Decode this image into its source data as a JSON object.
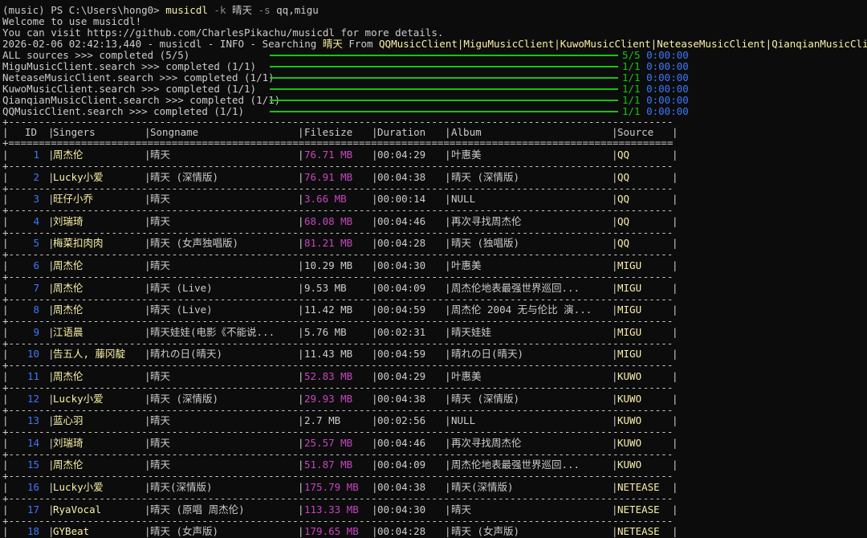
{
  "prompt": {
    "env": "(music) PS C:\\Users\\hong0> ",
    "cmd": "musicdl",
    "flag_k": "-k",
    "keyword": "晴天",
    "flag_s": "-s",
    "sources": "qq,migu"
  },
  "log": {
    "welcome": "Welcome to use musicdl!",
    "visit": "You can visit https://github.com/CharlesPikachu/musicdl for more details.",
    "info_prefix": "2026-02-06 02:42:13,440 - musicdl - INFO - Searching ",
    "info_keyword": "晴天",
    "info_from": " From ",
    "info_clients": "QQMusicClient|MiguMusicClient|KuwoMusicClient|NeteaseMusicClient|QianqianMusicClient"
  },
  "progress": [
    {
      "label": "ALL sources >>> completed (5/5)",
      "count": "5/5",
      "time": "0:00:00",
      "fraction": 1.0
    },
    {
      "label": "MiguMusicClient.search >>> completed (1/1)",
      "count": "1/1",
      "time": "0:00:00",
      "fraction": 1.0
    },
    {
      "label": "NeteaseMusicClient.search >>> completed (1/1)",
      "count": "1/1",
      "time": "0:00:00",
      "fraction": 1.0
    },
    {
      "label": "KuwoMusicClient.search >>> completed (1/1)",
      "count": "1/1",
      "time": "0:00:00",
      "fraction": 1.0
    },
    {
      "label": "QianqianMusicClient.search >>> completed (1/1)",
      "count": "1/1",
      "time": "0:00:00",
      "fraction": 1.0
    },
    {
      "label": "QQMusicClient.search >>> completed (1/1)",
      "count": "1/1",
      "time": "0:00:00",
      "fraction": 1.0
    }
  ],
  "table": {
    "columns": [
      "ID",
      "Singers",
      "Songname",
      "Filesize",
      "Duration",
      "Album",
      "Source"
    ],
    "rows": [
      {
        "id": "1",
        "singer": "周杰伦",
        "song": "晴天",
        "size": "76.71 MB",
        "dur": "00:04:29",
        "album": "叶惠美",
        "src": "QQ",
        "size_color": "#c745c0"
      },
      {
        "id": "2",
        "singer": "Lucky小爱",
        "song": "晴天 (深情版)",
        "size": "76.91 MB",
        "dur": "00:04:38",
        "album": "晴天 (深情版)",
        "src": "QQ",
        "size_color": "#c745c0"
      },
      {
        "id": "3",
        "singer": "旺仔小乔",
        "song": "晴天",
        "size": "3.66 MB",
        "dur": "00:00:14",
        "album": "NULL",
        "src": "QQ",
        "size_color": "#c745c0"
      },
      {
        "id": "4",
        "singer": "刘瑞琦",
        "song": "晴天",
        "size": "68.08 MB",
        "dur": "00:04:46",
        "album": "再次寻找周杰伦",
        "src": "QQ",
        "size_color": "#c745c0"
      },
      {
        "id": "5",
        "singer": "梅菜扣肉肉",
        "song": "晴天 (女声独唱版)",
        "size": "81.21 MB",
        "dur": "00:04:28",
        "album": "晴天 (独唱版)",
        "src": "QQ",
        "size_color": "#c745c0"
      },
      {
        "id": "6",
        "singer": "周杰伦",
        "song": "晴天",
        "size": "10.29 MB",
        "dur": "00:04:30",
        "album": "叶惠美",
        "src": "MIGU",
        "size_color": "#cccccc"
      },
      {
        "id": "7",
        "singer": "周杰伦",
        "song": "晴天 (Live)",
        "size": "9.53 MB",
        "dur": "00:04:09",
        "album": "周杰伦地表最强世界巡回...",
        "src": "MIGU",
        "size_color": "#cccccc"
      },
      {
        "id": "8",
        "singer": "周杰伦",
        "song": "晴天 (Live)",
        "size": "11.42 MB",
        "dur": "00:04:59",
        "album": "周杰伦 2004 无与伦比 演...",
        "src": "MIGU",
        "size_color": "#cccccc"
      },
      {
        "id": "9",
        "singer": "江语晨",
        "song": "晴天娃娃(电影《不能说...",
        "size": "5.76 MB",
        "dur": "00:02:31",
        "album": "晴天娃娃",
        "src": "MIGU",
        "size_color": "#cccccc"
      },
      {
        "id": "10",
        "singer": "告五人, 藤冈靛",
        "song": "晴れの日(晴天)",
        "size": "11.43 MB",
        "dur": "00:04:59",
        "album": "晴れの日(晴天)",
        "src": "MIGU",
        "size_color": "#cccccc"
      },
      {
        "id": "11",
        "singer": "周杰伦",
        "song": "晴天",
        "size": "52.83 MB",
        "dur": "00:04:29",
        "album": "叶惠美",
        "src": "KUWO",
        "size_color": "#c745c0"
      },
      {
        "id": "12",
        "singer": "Lucky小爱",
        "song": "晴天 (深情版)",
        "size": "29.93 MB",
        "dur": "00:04:38",
        "album": "晴天 (深情版)",
        "src": "KUWO",
        "size_color": "#c745c0"
      },
      {
        "id": "13",
        "singer": "蓝心羽",
        "song": "晴天",
        "size": "2.7 MB",
        "dur": "00:02:56",
        "album": "NULL",
        "src": "KUWO",
        "size_color": "#cccccc"
      },
      {
        "id": "14",
        "singer": "刘瑞琦",
        "song": "晴天",
        "size": "25.57 MB",
        "dur": "00:04:46",
        "album": "再次寻找周杰伦",
        "src": "KUWO",
        "size_color": "#c745c0"
      },
      {
        "id": "15",
        "singer": "周杰伦",
        "song": "晴天",
        "size": "51.87 MB",
        "dur": "00:04:09",
        "album": "周杰伦地表最强世界巡回...",
        "src": "KUWO",
        "size_color": "#c745c0"
      },
      {
        "id": "16",
        "singer": "Lucky小爱",
        "song": "晴天(深情版)",
        "size": "175.79 MB",
        "dur": "00:04:38",
        "album": "晴天(深情版)",
        "src": "NETEASE",
        "size_color": "#c745c0"
      },
      {
        "id": "17",
        "singer": "RyaVocal",
        "song": "晴天 (原唱 周杰伦)",
        "size": "113.33 MB",
        "dur": "00:04:30",
        "album": "晴天",
        "src": "NETEASE",
        "size_color": "#c745c0"
      },
      {
        "id": "18",
        "singer": "GYBeat",
        "song": "晴天 (女声版)",
        "size": "179.65 MB",
        "dur": "00:04:28",
        "album": "晴天 (女声版)",
        "src": "NETEASE",
        "size_color": "#c745c0"
      }
    ]
  },
  "colors": {
    "background": "#0c0c0c",
    "text": "#cccccc",
    "yellow": "#f9f1a5",
    "green": "#16c60c",
    "blue": "#3b78ff",
    "magenta": "#c745c0"
  }
}
